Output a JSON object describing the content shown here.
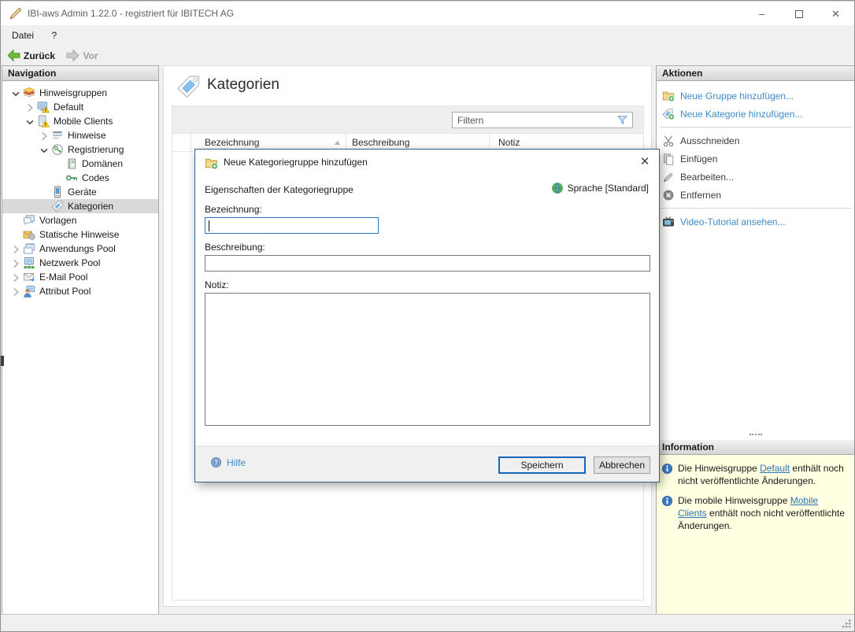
{
  "window": {
    "title": "IBI-aws Admin 1.22.0 - registriert für IBITECH AG",
    "controls": {
      "minimize": "–",
      "maximize": "",
      "close": "✕"
    }
  },
  "menubar": {
    "items": [
      {
        "label": "Datei"
      },
      {
        "label": "?"
      }
    ]
  },
  "toolbar": {
    "back_label": "Zurück",
    "forward_label": "Vor"
  },
  "navigation": {
    "header": "Navigation",
    "items": [
      {
        "label": "Hinweisgruppen",
        "icon": "hint-stack-icon",
        "indent": 0,
        "expander": "expanded",
        "selected": false
      },
      {
        "label": "Default",
        "icon": "monitor-warning-icon",
        "indent": 1,
        "expander": "collapsed",
        "selected": false
      },
      {
        "label": "Mobile Clients",
        "icon": "tablet-warning-icon",
        "indent": 1,
        "expander": "expanded",
        "selected": false
      },
      {
        "label": "Hinweise",
        "icon": "notes-icon",
        "indent": 2,
        "expander": "collapsed",
        "selected": false
      },
      {
        "label": "Registrierung",
        "icon": "registration-key-icon",
        "indent": 2,
        "expander": "expanded",
        "selected": false
      },
      {
        "label": "Domänen",
        "icon": "domain-icon",
        "indent": 3,
        "expander": "none",
        "selected": false
      },
      {
        "label": "Codes",
        "icon": "key-icon",
        "indent": 3,
        "expander": "none",
        "selected": false
      },
      {
        "label": "Geräte",
        "icon": "device-icon",
        "indent": 2,
        "expander": "none",
        "selected": false
      },
      {
        "label": "Kategorien",
        "icon": "tag-icon",
        "indent": 2,
        "expander": "none",
        "selected": true
      },
      {
        "label": "Vorlagen",
        "icon": "templates-icon",
        "indent": 0,
        "expander": "none",
        "selected": false
      },
      {
        "label": "Statische Hinweise",
        "icon": "static-notes-icon",
        "indent": 0,
        "expander": "none",
        "selected": false
      },
      {
        "label": "Anwendungs Pool",
        "icon": "app-pool-icon",
        "indent": 0,
        "expander": "collapsed",
        "selected": false
      },
      {
        "label": "Netzwerk Pool",
        "icon": "network-pool-icon",
        "indent": 0,
        "expander": "collapsed",
        "selected": false
      },
      {
        "label": "E-Mail Pool",
        "icon": "email-pool-icon",
        "indent": 0,
        "expander": "collapsed",
        "selected": false
      },
      {
        "label": "Attribut Pool",
        "icon": "attribute-pool-icon",
        "indent": 0,
        "expander": "collapsed",
        "selected": false
      }
    ]
  },
  "main": {
    "title": "Kategorien",
    "filter_placeholder": "Filtern",
    "columns": [
      {
        "label": "Bezeichnung",
        "sorted": "asc"
      },
      {
        "label": "Beschreibung"
      },
      {
        "label": "Notiz"
      }
    ]
  },
  "dialog": {
    "title": "Neue Kategoriegruppe hinzufügen",
    "section_label": "Eigenschaften der Kategoriegruppe",
    "language_label": "Sprache [Standard]",
    "close_glyph": "✕",
    "fields": [
      {
        "label": "Bezeichnung:",
        "value": ""
      },
      {
        "label": "Beschreibung:",
        "value": ""
      },
      {
        "label": "Notiz:",
        "value": ""
      }
    ],
    "help_label": "Hilfe",
    "save_label": "Speichern",
    "cancel_label": "Abbrechen"
  },
  "actions": {
    "header": "Aktionen",
    "items": [
      {
        "type": "link",
        "label": "Neue Gruppe hinzufügen...",
        "icon": "folder-add-icon"
      },
      {
        "type": "link",
        "label": "Neue Kategorie hinzufügen...",
        "icon": "tag-add-icon"
      },
      {
        "type": "divider"
      },
      {
        "type": "normal",
        "label": "Ausschneiden",
        "icon": "scissors-icon"
      },
      {
        "type": "normal",
        "label": "Einfügen",
        "icon": "paste-icon"
      },
      {
        "type": "normal",
        "label": "Bearbeiten...",
        "icon": "pencil-icon"
      },
      {
        "type": "normal",
        "label": "Entfernen",
        "icon": "remove-icon"
      },
      {
        "type": "divider"
      },
      {
        "type": "link",
        "label": "Video-Tutorial ansehen...",
        "icon": "video-icon"
      }
    ]
  },
  "information": {
    "header": "Information",
    "items": [
      {
        "parts": [
          {
            "text": "Die Hinweisgruppe "
          },
          {
            "text": "Default",
            "link": true
          },
          {
            "text": " enthält noch nicht veröffentlichte Änderungen."
          }
        ]
      },
      {
        "parts": [
          {
            "text": "Die mobile Hinweisgruppe "
          },
          {
            "text": "Mobile Clients",
            "link": true
          },
          {
            "text": " enthält noch nicht veröffentlichte Änderungen."
          }
        ]
      }
    ]
  },
  "colors": {
    "accent_blue": "#1467b8",
    "action_link": "#3f8ac9",
    "info_link": "#2e75b6",
    "info_panel_bg": "#ffffe1",
    "selection_bg": "#d9d9d9",
    "dialog_border": "#35618f"
  }
}
